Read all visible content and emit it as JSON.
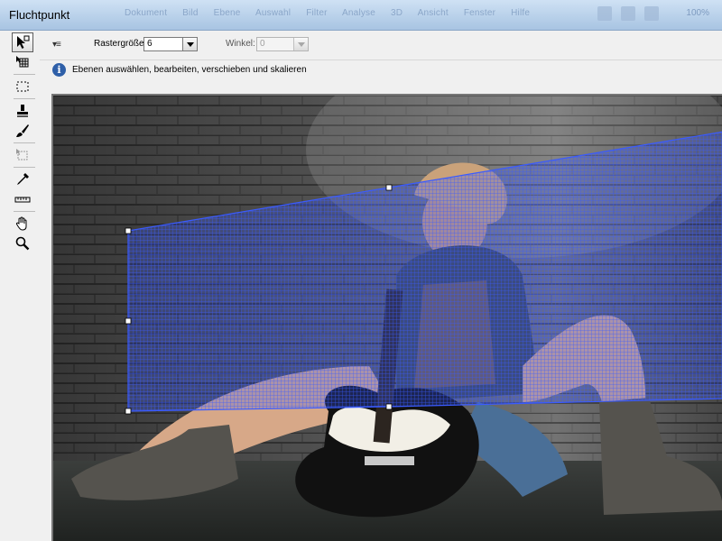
{
  "window": {
    "title": "Fluchtpunkt",
    "background_menu": [
      "Dokument",
      "Bild",
      "Ebene",
      "Auswahl",
      "Filter",
      "Analyse",
      "3D",
      "Ansicht",
      "Fenster",
      "Hilfe"
    ],
    "background_zoom": "100%"
  },
  "options": {
    "grid_size_label": "Rastergröße:",
    "grid_size_value": "6",
    "angle_label": "Winkel:",
    "angle_value": "0"
  },
  "info": {
    "text": "Ebenen auswählen, bearbeiten, verschieben und skalieren"
  },
  "tools": [
    {
      "name": "edit-plane-tool-icon",
      "active": true
    },
    {
      "name": "create-plane-tool-icon",
      "active": false
    },
    {
      "name": "marquee-tool-icon",
      "active": false
    },
    {
      "name": "stamp-tool-icon",
      "active": false
    },
    {
      "name": "brush-tool-icon",
      "active": false
    },
    {
      "name": "transform-tool-icon",
      "active": false
    },
    {
      "name": "eyedropper-tool-icon",
      "active": false
    },
    {
      "name": "measure-tool-icon",
      "active": false
    },
    {
      "name": "hand-tool-icon",
      "active": false
    },
    {
      "name": "zoom-tool-icon",
      "active": false
    }
  ],
  "colors": {
    "plane_grid": "#3a5bff",
    "title_bar": "#b9d1ea"
  }
}
